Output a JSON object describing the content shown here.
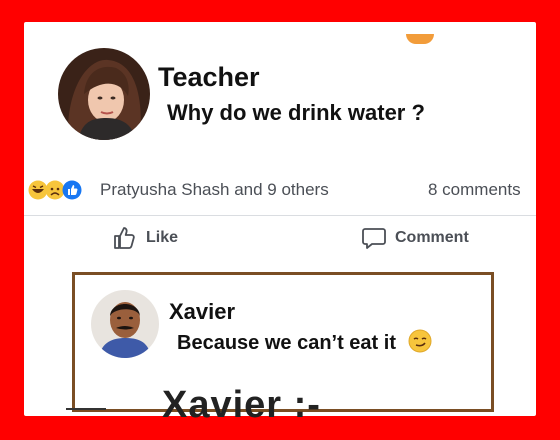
{
  "post": {
    "author": "Teacher",
    "text": "Why do we drink water ?",
    "reactions_text": "Pratyusha Shash and 9 others",
    "comment_count": "8 comments"
  },
  "actions": {
    "like_label": "Like",
    "comment_label": "Comment"
  },
  "comment": {
    "author": "Xavier",
    "text": "Because we can’t eat it"
  },
  "caption": "Xavier :-",
  "icons": {
    "reactions": [
      "haha-icon",
      "sad-icon",
      "like-reaction-icon"
    ],
    "like": "thumbs-up-icon",
    "comment": "speech-bubble-icon",
    "comment_emoji": "smirk-emoji-icon"
  },
  "colors": {
    "frame": "#ff0000",
    "comment_border": "#7a4e24",
    "like_reaction": "#1877f2",
    "emoji": "#f7c53c"
  }
}
